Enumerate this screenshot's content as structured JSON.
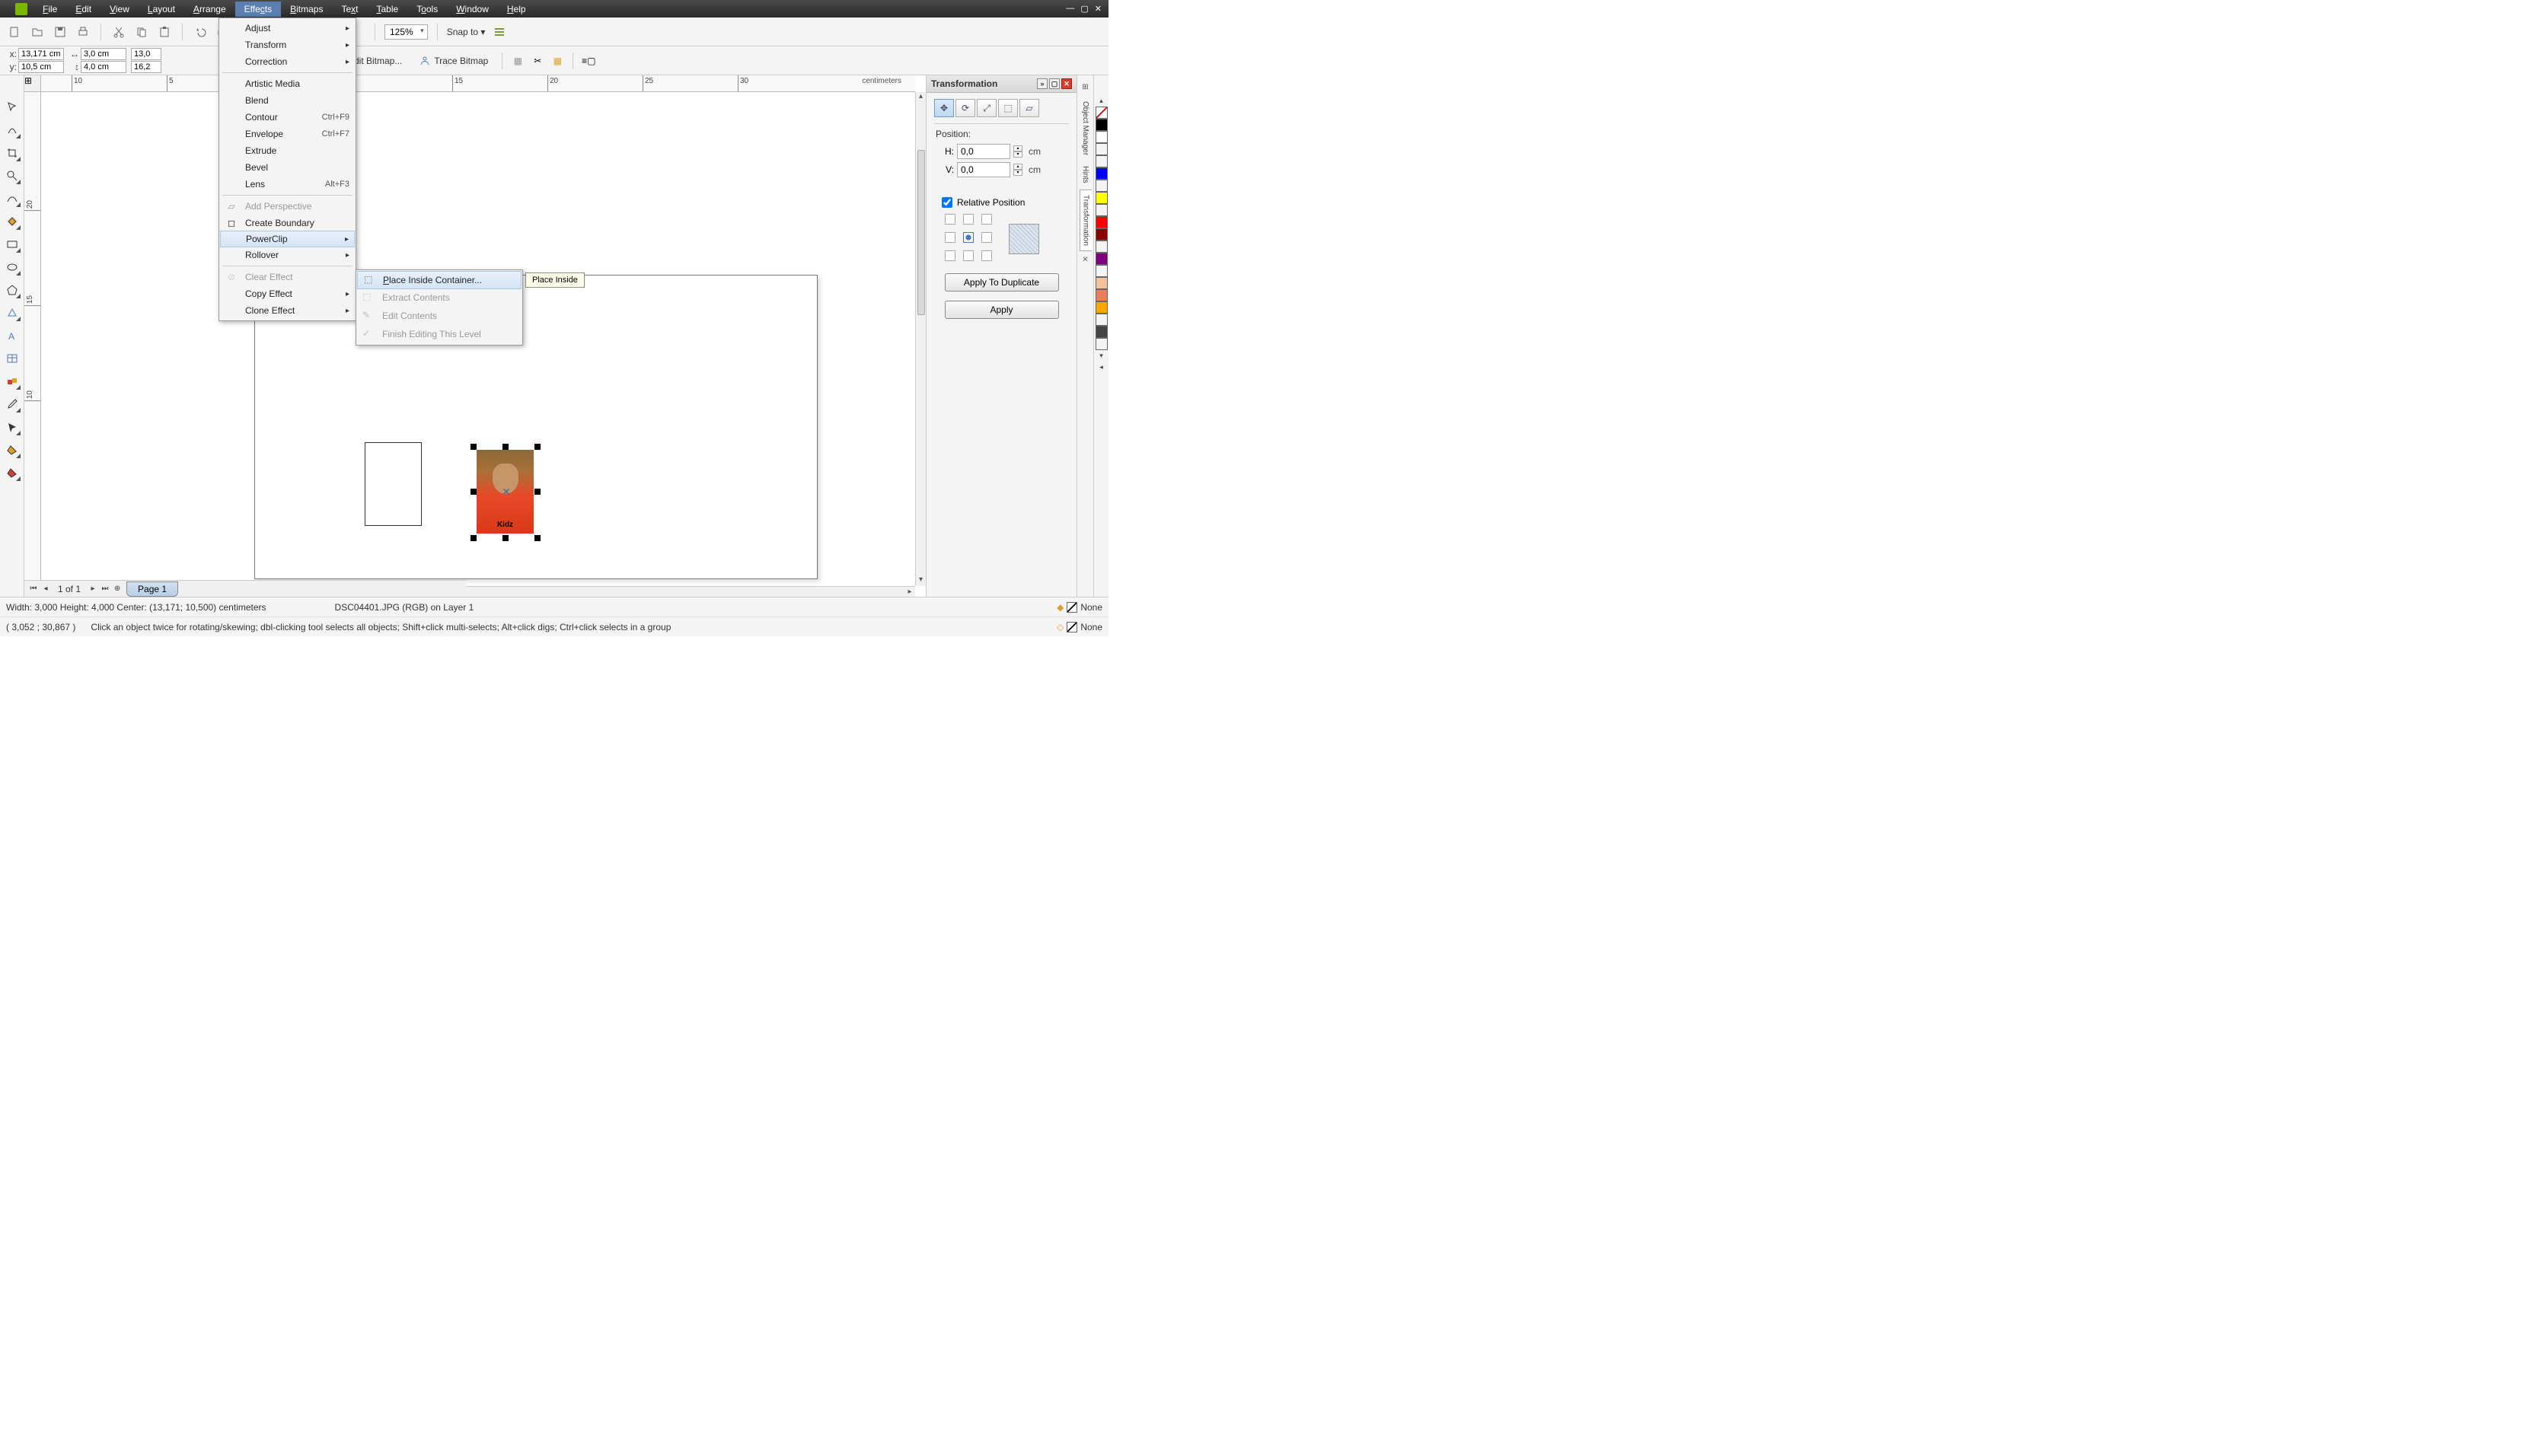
{
  "menubar": {
    "items": [
      "File",
      "Edit",
      "View",
      "Layout",
      "Arrange",
      "Effects",
      "Bitmaps",
      "Text",
      "Table",
      "Tools",
      "Window",
      "Help"
    ],
    "active": "Effects"
  },
  "toolbar": {
    "zoom": "125%",
    "snap_label": "Snap to"
  },
  "property_bar": {
    "x": "13,171 cm",
    "y": "10,5 cm",
    "w": "3,0 cm",
    "h": "4,0 cm",
    "sx": "13,0",
    "sy": "16,2",
    "edit_bitmap": "Edit Bitmap...",
    "trace_bitmap": "Trace Bitmap"
  },
  "effects_menu": {
    "adjust": "Adjust",
    "transform": "Transform",
    "correction": "Correction",
    "artistic_media": "Artistic Media",
    "blend": "Blend",
    "contour": "Contour",
    "contour_sc": "Ctrl+F9",
    "envelope": "Envelope",
    "envelope_sc": "Ctrl+F7",
    "extrude": "Extrude",
    "bevel": "Bevel",
    "lens": "Lens",
    "lens_sc": "Alt+F3",
    "add_perspective": "Add Perspective",
    "create_boundary": "Create Boundary",
    "powerclip": "PowerClip",
    "rollover": "Rollover",
    "clear_effect": "Clear Effect",
    "copy_effect": "Copy Effect",
    "clone_effect": "Clone Effect"
  },
  "powerclip_submenu": {
    "place_inside": "Place Inside Container...",
    "extract": "Extract Contents",
    "edit_contents": "Edit Contents",
    "finish_editing": "Finish Editing This Level"
  },
  "tooltip": "Place Inside",
  "ruler": {
    "units": "centimeters",
    "h_ticks": [
      "10",
      "5",
      "15",
      "20",
      "25",
      "30"
    ],
    "v_ticks": [
      "20",
      "15",
      "10"
    ]
  },
  "canvas_objects": {
    "photo_text": "Kidz"
  },
  "pagetabs": {
    "count": "1 of 1",
    "tab1": "Page 1"
  },
  "docker": {
    "title": "Transformation",
    "section_label": "Position:",
    "h_label": "H:",
    "h_value": "0,0",
    "v_label": "V:",
    "v_value": "0,0",
    "unit": "cm",
    "relative": "Relative Position",
    "apply_dup": "Apply To Duplicate",
    "apply": "Apply",
    "side_tabs": [
      "Object Manager",
      "Hints",
      "Transformation"
    ]
  },
  "colors": [
    "#000000",
    "#ffffff",
    "#0000ff",
    "transparent",
    "#ffff00",
    "#ff0000",
    "#8b0000",
    "#800080",
    "#f5c29a",
    "#e88060",
    "#ffa500",
    "#444444"
  ],
  "status": {
    "dims": "Width: 3,000  Height: 4,000  Center: (13,171; 10,500)  centimeters",
    "object": "DSC04401.JPG (RGB) on Layer 1",
    "fill_none": "None",
    "outline_none": "None",
    "cursor": "( 3,052 ; 30,867 )",
    "hint": "Click an object twice for rotating/skewing; dbl-clicking tool selects all objects; Shift+click multi-selects; Alt+click digs; Ctrl+click selects in a group"
  }
}
